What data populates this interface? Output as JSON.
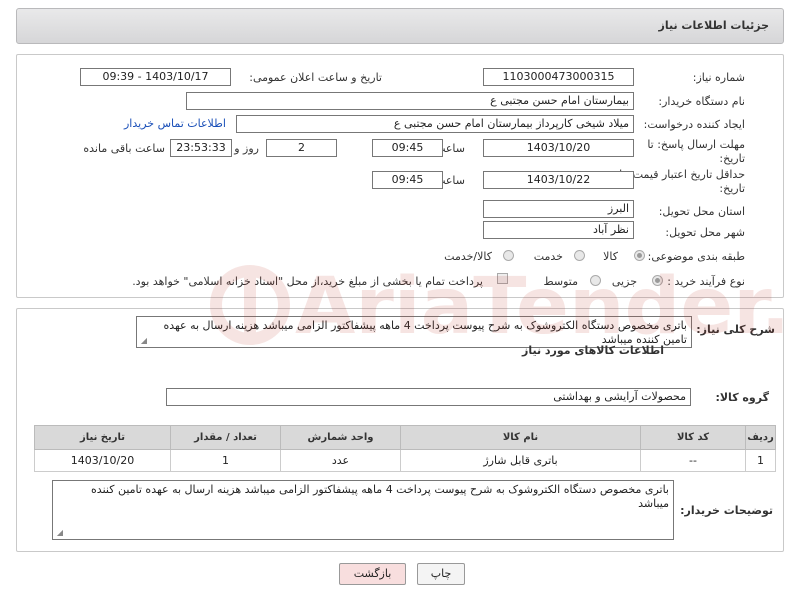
{
  "header": {
    "title": "جزئیات اطلاعات نیاز"
  },
  "form": {
    "need_number_label": "شماره نیاز:",
    "need_number": "1103000473000315",
    "announce_label": "تاریخ و ساعت اعلان عمومی:",
    "announce_value": "1403/10/17 - 09:39",
    "buyer_org_label": "نام دستگاه خریدار:",
    "buyer_org": "بیمارستان امام حسن مجتبی ع",
    "requester_label": "ایجاد کننده درخواست:",
    "requester": "میلاد شیخی کارپرداز بیمارستان امام حسن مجتبی ع",
    "contact_link": "اطلاعات تماس خریدار",
    "deadline_label_1": "مهلت ارسال پاسخ: تا",
    "deadline_label_2": "تاریخ:",
    "deadline_date": "1403/10/20",
    "time_label": "ساعت",
    "deadline_time": "09:45",
    "days_value": "2",
    "days_label": "روز و",
    "remaining_value": "23:53:33",
    "remaining_label": "ساعت باقی مانده",
    "validity_label_1": "حداقل تاریخ اعتبار قیمت: تا",
    "validity_label_2": "تاریخ:",
    "validity_date": "1403/10/22",
    "validity_time": "09:45",
    "province_label": "استان محل تحویل:",
    "province": "البرز",
    "city_label": "شهر محل تحویل:",
    "city": "نظر آباد",
    "category_label": "طبقه بندی موضوعی:",
    "cat_goods": "کالا",
    "cat_service": "خدمت",
    "cat_goods_service": "کالا/خدمت",
    "process_label": "نوع فرآیند خرید :",
    "proc_minor": "جزیی",
    "proc_medium": "متوسط",
    "payment_note": "پرداخت تمام یا بخشی از مبلغ خرید،از محل \"اسناد خزانه اسلامی\" خواهد بود."
  },
  "details": {
    "summary_label": "شرح کلی نیاز:",
    "summary": "باتری مخصوص دستگاه الکتروشوک به شرح پیوست پرداخت 4 ماهه پیشفاکتور الزامی میباشد هزینه ارسال به عهده تامین کننده میباشد",
    "items_title": "اطلاعات کالاهای مورد نیاز",
    "group_label": "گروه کالا:",
    "group_value": "محصولات آرایشی و بهداشتی",
    "columns": [
      "ردیف",
      "کد کالا",
      "نام کالا",
      "واحد شمارش",
      "تعداد / مقدار",
      "تاریخ نیاز"
    ],
    "rows": [
      {
        "index": "1",
        "code": "--",
        "name": "باتری قابل شارژ",
        "unit": "عدد",
        "qty": "1",
        "date": "1403/10/20"
      }
    ],
    "buyer_notes_label": "توضیحات خریدار:",
    "buyer_notes": "باتری مخصوص دستگاه الکتروشوک به شرح پیوست پرداخت 4 ماهه پیشفاکتور الزامی میباشد هزینه ارسال به عهده تامین کننده میباشد"
  },
  "buttons": {
    "print": "چاپ",
    "back": "بازگشت"
  },
  "watermark": {
    "text": "AriaTender.neT"
  },
  "colors": {
    "link": "#1a4fb8",
    "back_button_bg": "#f8dede",
    "watermark": "#c0392b"
  }
}
